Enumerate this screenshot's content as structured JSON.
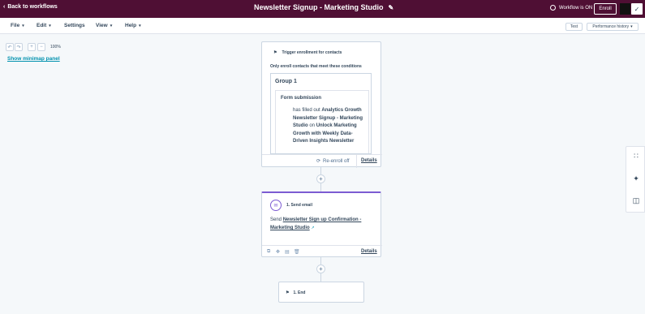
{
  "topbar": {
    "back_label": "Back to workflows",
    "title": "Newsletter Signup - Marketing Studio",
    "status": "Workflow is ON",
    "enroll_label": "Enroll"
  },
  "menubar": {
    "items": [
      "File",
      "Edit",
      "Settings",
      "View",
      "Help"
    ],
    "test_label": "Test",
    "performance_label": "Performance history"
  },
  "canvas": {
    "zoom": "100%",
    "minimap_label": "Show minimap panel"
  },
  "trigger": {
    "heading": "Trigger enrollment for contacts",
    "subheading": "Only enroll contacts that meet these conditions",
    "group_title": "Group 1",
    "filter_title": "Form submission",
    "filter_prefix": "has filled out",
    "filter_form": "Analytics Growth Newsletter Signup - Marketing Studio",
    "filter_on": "on",
    "filter_page": "Unlock Marketing Growth with Weekly Data-Driven Insights Newsletter",
    "reenroll_label": "Re-enroll off",
    "details_label": "Details"
  },
  "email_action": {
    "title": "1. Send email",
    "send_prefix": "Send",
    "email_name": "Newsletter Sign up Confirmation - Marketing Studio",
    "details_label": "Details"
  },
  "end_action": {
    "label": "1. End"
  },
  "colors": {
    "topbar_bg": "#4f0f34",
    "accent_purple": "#7c5bd2",
    "link_teal": "#0091ae"
  }
}
